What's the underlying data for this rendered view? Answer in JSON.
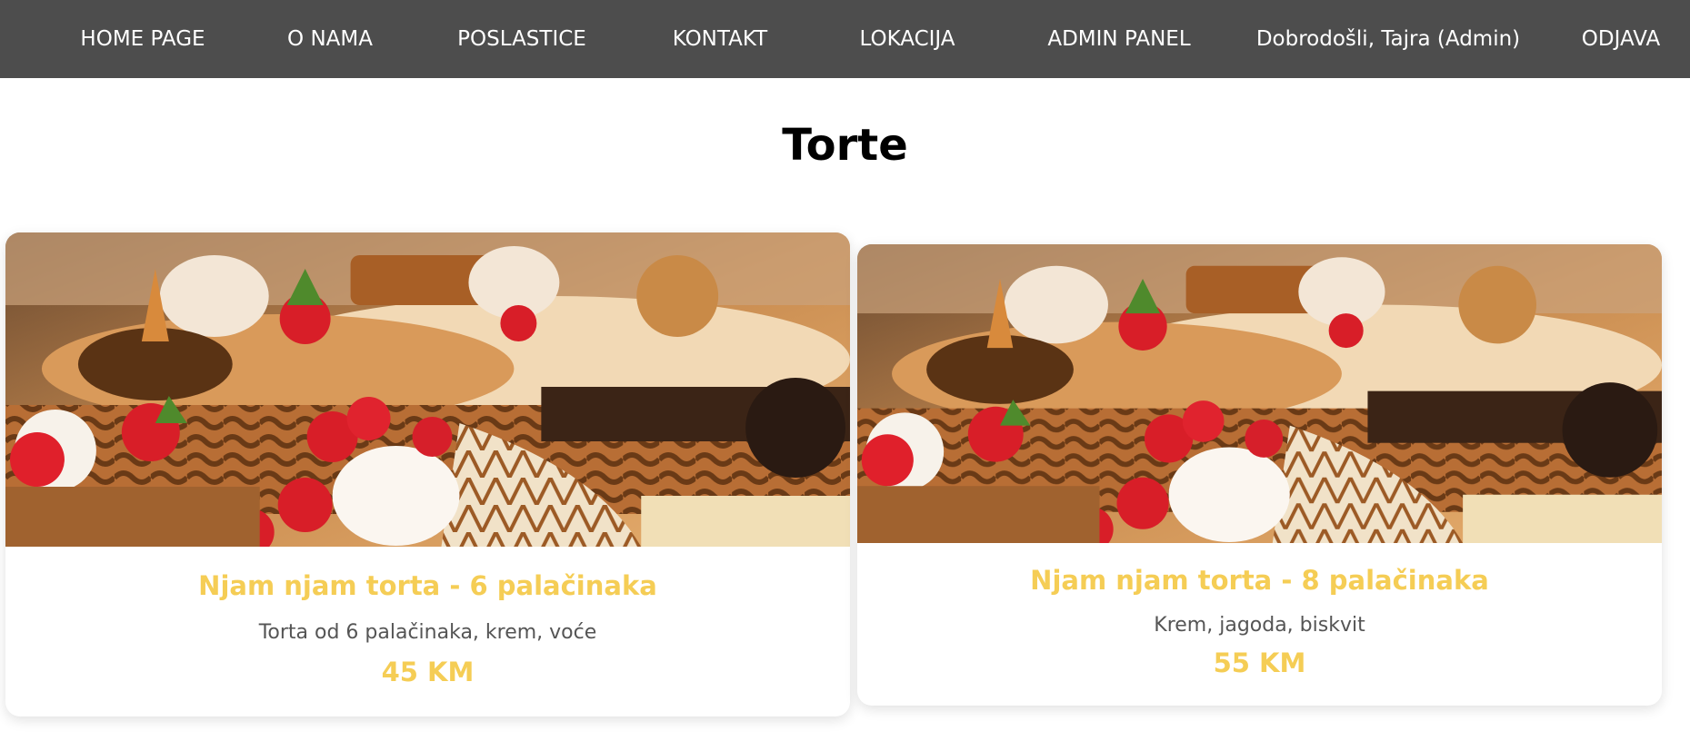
{
  "nav": {
    "items": [
      {
        "label": "HOME PAGE"
      },
      {
        "label": "O NAMA"
      },
      {
        "label": "POSLASTICE"
      },
      {
        "label": "KONTAKT"
      },
      {
        "label": "LOKACIJA"
      },
      {
        "label": "ADMIN PANEL"
      },
      {
        "label": "Dobrodošli, Tajra (Admin)"
      },
      {
        "label": "ODJAVA"
      }
    ]
  },
  "page": {
    "title": "Torte"
  },
  "products": [
    {
      "name": "Njam njam torta - 6 palačinaka",
      "description": "Torta od 6 palačinaka, krem, voće",
      "price": "45 KM"
    },
    {
      "name": "Njam njam torta - 8 palačinaka",
      "description": "Krem, jagoda, biskvit",
      "price": "55 KM"
    }
  ],
  "colors": {
    "navbar_bg": "#4d4d4d",
    "accent": "#f5cd55",
    "text_muted": "#555555"
  }
}
